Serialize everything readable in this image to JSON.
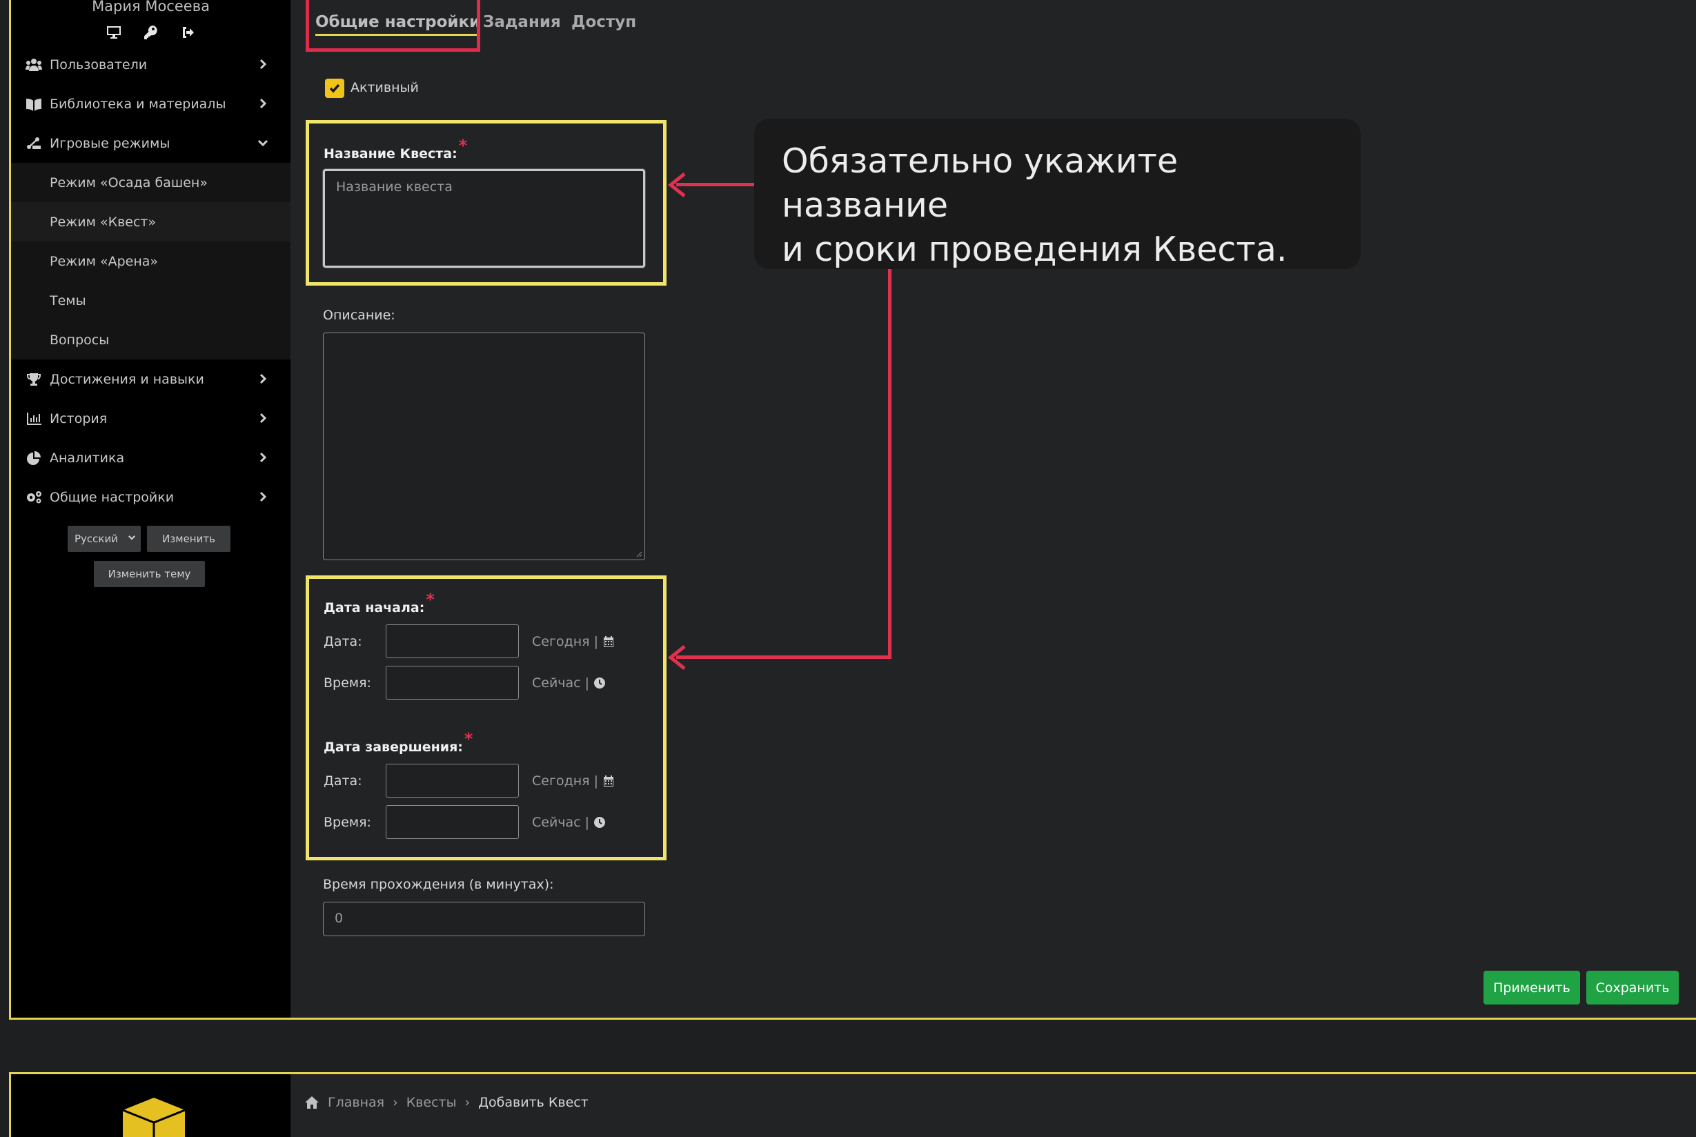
{
  "sidebar": {
    "user_name": "Мария Мосеева",
    "user_icons": [
      "monitor-icon",
      "key-icon",
      "sign-out-icon"
    ],
    "items": [
      {
        "label": "Пользователи",
        "icon": "users-icon"
      },
      {
        "label": "Библиотека и материалы",
        "icon": "book-icon"
      },
      {
        "label": "Игровые режимы",
        "icon": "game-modes-icon",
        "expanded": true
      },
      {
        "label": "Достижения и навыки",
        "icon": "trophy-icon"
      },
      {
        "label": "История",
        "icon": "chart-icon"
      },
      {
        "label": "Аналитика",
        "icon": "pie-chart-icon"
      },
      {
        "label": "Общие настройки",
        "icon": "gears-icon"
      }
    ],
    "subitems": [
      {
        "label": "Режим «Осада башен»"
      },
      {
        "label": "Режим «Квест»",
        "active": true
      },
      {
        "label": "Режим «Арена»"
      },
      {
        "label": "Темы"
      },
      {
        "label": "Вопросы"
      }
    ],
    "language": "Русский",
    "change_button": "Изменить",
    "change_theme_button": "Изменить тему"
  },
  "tabs": [
    {
      "label": "Общие настройки",
      "active": true
    },
    {
      "label": "Задания"
    },
    {
      "label": "Доступ"
    }
  ],
  "form": {
    "active_label": "Активный",
    "active_checked": true,
    "quest_name_label": "Название Квеста:",
    "quest_name_placeholder": "Название квеста",
    "required_mark": "*",
    "description_label": "Описание:",
    "start_label": "Дата начала:",
    "end_label": "Дата завершения:",
    "date_label": "Дата:",
    "time_label": "Время:",
    "today_link": "Сегодня |",
    "now_link": "Сейчас |",
    "duration_label": "Время прохождения (в минутах):",
    "duration_value": "0"
  },
  "buttons": {
    "apply": "Применить",
    "save": "Сохранить"
  },
  "callout": {
    "line1": "Обязательно укажите название",
    "line2": "и сроки проведения Квеста."
  },
  "breadcrumb": {
    "home": "Главная",
    "sep": "›",
    "quests": "Квесты",
    "current": "Добавить Квест"
  },
  "colors": {
    "accent_yellow": "#e4d44f",
    "annotation_red": "#e0324f",
    "green_button": "#1fa344",
    "checkbox": "#f0c419"
  }
}
